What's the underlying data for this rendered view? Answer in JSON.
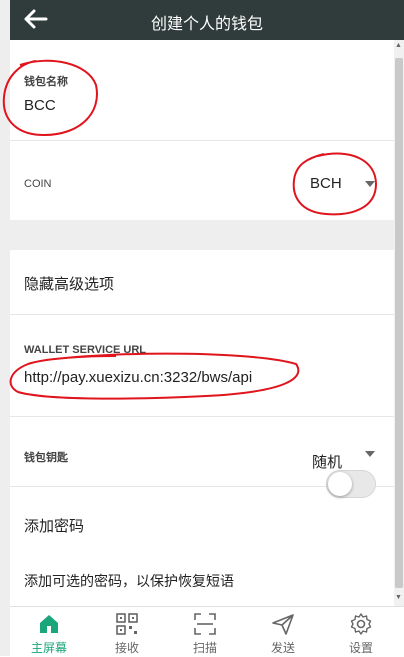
{
  "header": {
    "title": "创建个人的钱包"
  },
  "form": {
    "wallet_name_label": "钱包名称",
    "wallet_name_value": "BCC",
    "coin_label": "COIN",
    "coin_value": "BCH",
    "hide_advanced_label": "隐藏高级选项",
    "service_url_label": "WALLET SERVICE URL",
    "service_url_value": "http://pay.xuexizu.cn:3232/bws/api",
    "wallet_key_label": "钱包钥匙",
    "wallet_key_value": "随机",
    "add_password_label": "添加密码",
    "add_password_enabled": false,
    "optional_password_hint": "添加可选的密码，以保护恢复短语"
  },
  "tabs": [
    {
      "label": "主屏幕",
      "icon": "home-icon",
      "active": true
    },
    {
      "label": "接收",
      "icon": "qr-code-icon",
      "active": false
    },
    {
      "label": "扫描",
      "icon": "scan-icon",
      "active": false
    },
    {
      "label": "发送",
      "icon": "send-icon",
      "active": false
    },
    {
      "label": "设置",
      "icon": "gear-icon",
      "active": false
    }
  ],
  "colors": {
    "header_bg": "#2f3c3b",
    "accent": "#1aa57a",
    "annotation": "#e0141c"
  }
}
